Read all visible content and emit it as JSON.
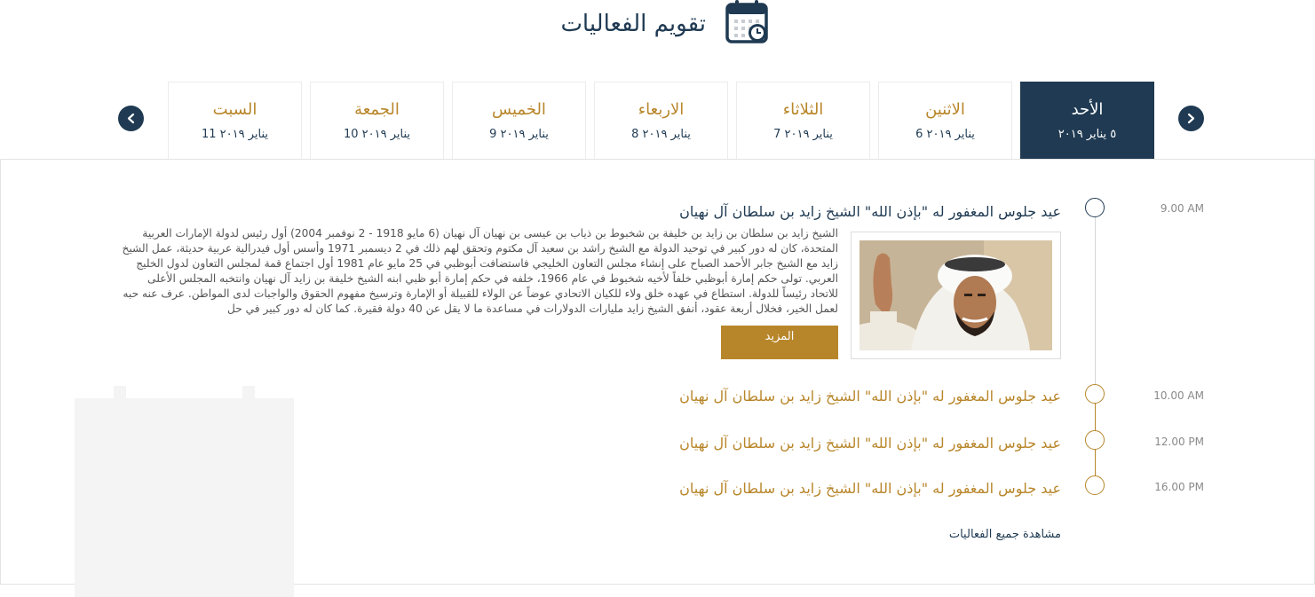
{
  "header": {
    "title": "تقويم الفعاليات",
    "icon": "calendar-clock-icon"
  },
  "colors": {
    "navy": "#1f3a52",
    "gold": "#b8862a",
    "border": "#e3e3e3"
  },
  "days": [
    {
      "name": "الأحد",
      "date": "٥ يناير ٢٠١٩",
      "active": true
    },
    {
      "name": "الاثنين",
      "date": "يناير ٢٠١٩ 6"
    },
    {
      "name": "الثلاثاء",
      "date": "يناير ٢٠١٩ 7"
    },
    {
      "name": "الاربعاء",
      "date": "يناير ٢٠١٩ 8"
    },
    {
      "name": "الخميس",
      "date": "يناير ٢٠١٩ 9"
    },
    {
      "name": "الجمعة",
      "date": "يناير ٢٠١٩ 10"
    },
    {
      "name": "السبت",
      "date": "يناير ٢٠١٩ 11"
    }
  ],
  "nav": {
    "prev_icon": "chevron-right-icon",
    "next_icon": "chevron-left-icon"
  },
  "events": [
    {
      "time": "9.00 AM",
      "title": "عيد جلوس المغفور له \"بإذن الله\" الشيخ زايد بن سلطان آل نهيان",
      "description": "الشيخ زايد بن سلطان بن زايد بن خليفة بن شخبوط بن ذياب بن عيسى بن نهيان آل نهيان (6 مايو 1918 - 2 نوفمبر 2004) أول رئيس لدولة الإمارات العربية المتحدة، كان له دور كبير في توحيد الدولة مع الشيخ راشد بن سعيد آل مكتوم وتحقق لهم ذلك في 2 ديسمبر 1971 وأسس أول فيدرالية عربية حديثة، عمل الشيخ زايد مع الشيخ جابر الأحمد الصباح على إنشاء مجلس التعاون الخليجي فاستضافت أبوظبي في 25 مايو عام 1981 أول اجتماع قمة لمجلس التعاون لدول الخليج العربي. تولى حكم إمارة أبوظبي خلفاً لأخيه شخبوط في عام 1966، خلفه في حكم إمارة أبو ظبي ابنه الشيخ خليفة بن زايد آل نهيان وانتخبه المجلس الأعلى للاتحاد رئيساً للدولة. استطاع في عهده خلق ولاء للكيان الاتحادي عوضاً عن الولاء للقبيلة أو الإمارة وترسيخ مفهوم الحقوق والواجبات لدى المواطن. عرف عنه حبه لعمل الخير، فخلال أربعة عقود، أنفق الشيخ زايد مليارات الدولارات في مساعدة ما لا يقل عن 40 دولة فقيرة. كما كان له دور كبير في حل",
      "more_label": "المزيد",
      "expanded": true
    },
    {
      "time": "10.00 AM",
      "title": "عيد جلوس المغفور له \"بإذن الله\" الشيخ زايد بن سلطان آل نهيان"
    },
    {
      "time": "12.00 PM",
      "title": "عيد جلوس المغفور له \"بإذن الله\" الشيخ زايد بن سلطان آل نهيان"
    },
    {
      "time": "16.00 PM",
      "title": "عيد جلوس المغفور له \"بإذن الله\" الشيخ زايد بن سلطان آل نهيان"
    }
  ],
  "view_all_label": "مشاهدة جميع الفعاليات"
}
